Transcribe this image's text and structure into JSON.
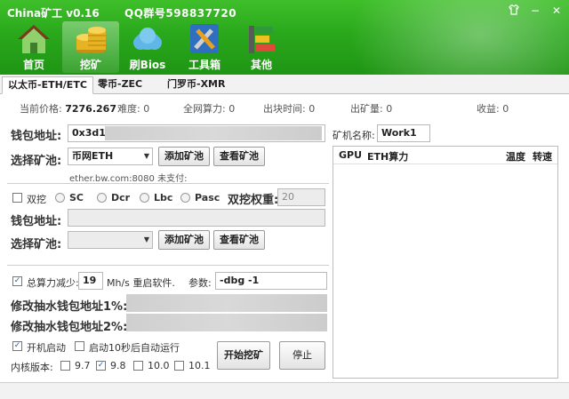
{
  "app": {
    "title": "China矿工 v0.16",
    "qq_group": "QQ群号598837720"
  },
  "window": {
    "skin_icon": "shirt-icon",
    "minimize": "−",
    "close": "✕"
  },
  "nav": [
    {
      "label": "首页",
      "icon": "home-icon"
    },
    {
      "label": "挖矿",
      "icon": "coins-icon",
      "active": true
    },
    {
      "label": "刷Bios",
      "icon": "cloud-icon"
    },
    {
      "label": "工具箱",
      "icon": "tools-icon"
    },
    {
      "label": "其他",
      "icon": "bars-icon"
    }
  ],
  "tabs": [
    "以太币-ETH/ETC",
    "零币-ZEC",
    "门罗币-XMR"
  ],
  "stats": {
    "price_label": "当前价格:",
    "price_value": "7276.267",
    "difficulty_label": "难度:",
    "difficulty_value": "0",
    "network_label": "全网算力:",
    "network_value": "0",
    "blocktime_label": "出块时间:",
    "blocktime_value": "0",
    "output_label": "出矿量:",
    "output_value": "0",
    "income_label": "收益:",
    "income_value": "0"
  },
  "wallet": {
    "label": "钱包地址:",
    "value": "0x3d1c"
  },
  "miner_name": {
    "label": "矿机名称:",
    "value": "Work1"
  },
  "pool": {
    "label": "选择矿池:",
    "selected": "币网ETH",
    "add_button": "添加矿池",
    "view_button": "查看矿池",
    "info": "ether.bw.com:8080  未支付:"
  },
  "dual": {
    "checkbox_label": "双挖",
    "options": [
      "SC",
      "Dcr",
      "Lbc",
      "Pasc"
    ],
    "weight_label": "双挖权重:",
    "weight_value": "20",
    "wallet_label": "钱包地址:",
    "pool_label": "选择矿池:",
    "add_button": "添加矿池",
    "view_button": "查看矿池"
  },
  "gpu_table": {
    "columns": [
      "GPU",
      "ETH算力",
      "温度",
      "转速"
    ]
  },
  "hashrate": {
    "checkbox_label": "总算力减少:",
    "value": "19",
    "unit": "Mh/s 重启软件.",
    "params_label": "参数:",
    "params_value": "-dbg -1"
  },
  "fee": {
    "label1": "修改抽水钱包地址1%:",
    "label2": "修改抽水钱包地址2%:"
  },
  "startup": {
    "auto_start": "开机启动",
    "auto_run": "启动10秒后自动运行",
    "kernel_label": "内核版本:",
    "kernels": [
      "9.7",
      "9.8",
      "10.0",
      "10.1"
    ],
    "kernel_checked": "9.8",
    "start_button": "开始挖矿",
    "stop_button": "停止"
  },
  "colors": {
    "header": "#2aa81c",
    "accent": "#1f9514"
  }
}
